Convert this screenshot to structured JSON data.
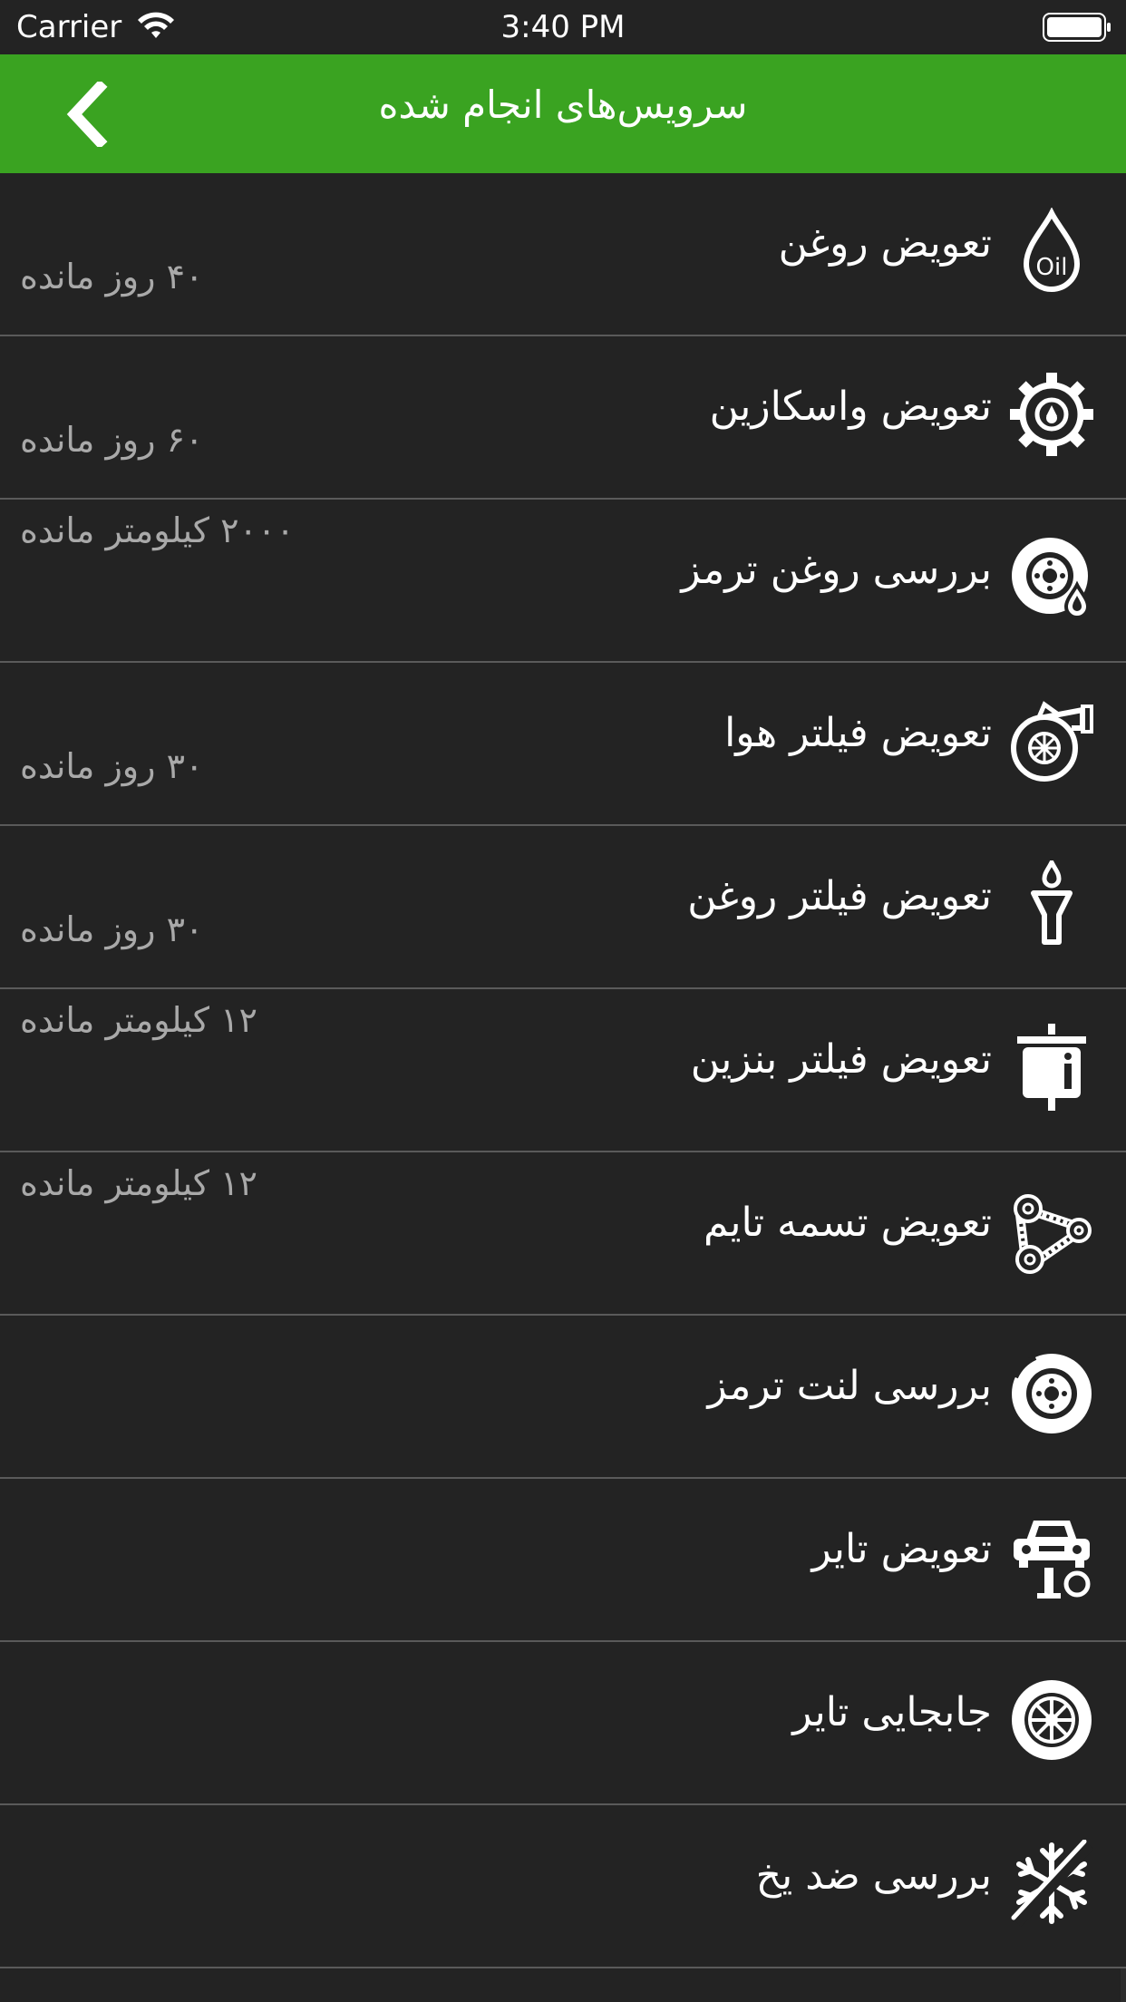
{
  "status_bar": {
    "carrier": "Carrier",
    "time": "3:40 PM"
  },
  "nav": {
    "title": "سرویس‌های انجام شده",
    "back_icon": "chevron-left-icon"
  },
  "colors": {
    "nav_background": "#3aa321",
    "background": "#232323",
    "title_text": "#ffffff",
    "remaining_text": "#a9a9a9",
    "divider": "#5a5a5a"
  },
  "services": [
    {
      "title": "تعویض روغن",
      "remaining": "۴۰ روز مانده",
      "icon": "oil-drop-icon"
    },
    {
      "title": "تعویض واسکازین",
      "remaining": "۶۰ روز مانده",
      "icon": "gear-icon"
    },
    {
      "title": "بررسی روغن ترمز",
      "remaining": "۲۰۰۰ کیلومتر مانده",
      "icon": "brake-fluid-icon"
    },
    {
      "title": "تعویض فیلتر هوا",
      "remaining": "۳۰ روز مانده",
      "icon": "air-filter-icon"
    },
    {
      "title": "تعویض فیلتر روغن",
      "remaining": "۳۰ روز مانده",
      "icon": "oil-filter-icon"
    },
    {
      "title": "تعویض فیلتر بنزین",
      "remaining": "۱۲ کیلومتر مانده",
      "icon": "fuel-filter-icon"
    },
    {
      "title": "تعویض تسمه تایم",
      "remaining": "۱۲ کیلومتر مانده",
      "icon": "timing-belt-icon"
    },
    {
      "title": "بررسی لنت ترمز",
      "remaining": "",
      "icon": "brake-disc-icon"
    },
    {
      "title": "تعویض تایر",
      "remaining": "",
      "icon": "car-lift-icon"
    },
    {
      "title": "جابجایی تایر",
      "remaining": "",
      "icon": "wheel-icon"
    },
    {
      "title": "بررسی ضد یخ",
      "remaining": "",
      "icon": "antifreeze-icon"
    }
  ]
}
